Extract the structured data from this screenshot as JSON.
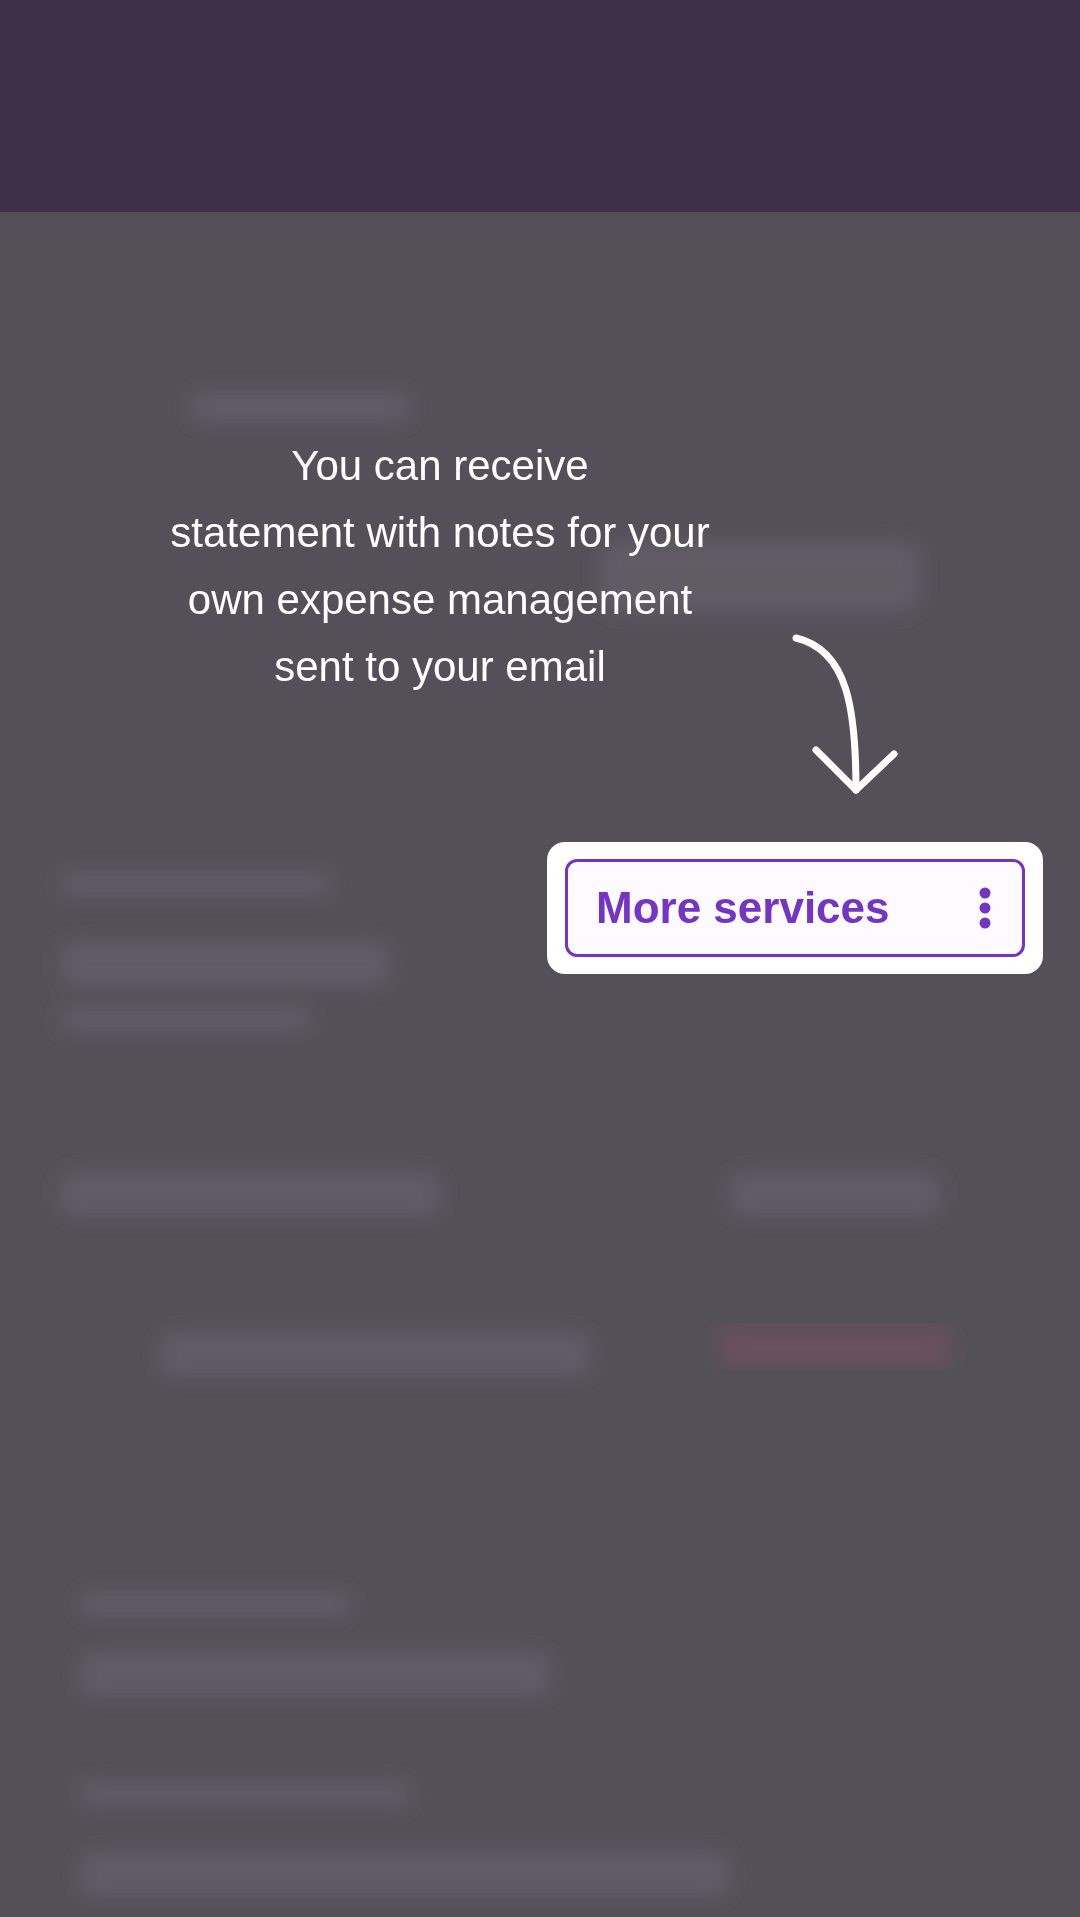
{
  "tip": {
    "text": "You can receive\nstatement with notes for your\nown expense management\nsent to your email"
  },
  "highlight": {
    "label": "More services"
  }
}
